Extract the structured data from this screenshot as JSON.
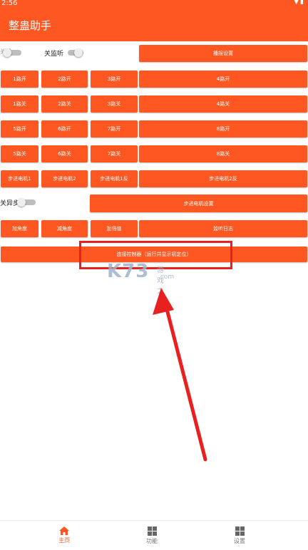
{
  "status": {
    "time": "2:56"
  },
  "app": {
    "title": "整蛊助手"
  },
  "row1": {
    "switch1_label": "关监听",
    "switch_prefix": "关提",
    "broadcast": "播报设置"
  },
  "row2": [
    "1路开",
    "2路开",
    "3路开",
    "4路开"
  ],
  "row3": [
    "1路关",
    "2路关",
    "3路关",
    "4路关"
  ],
  "row4": [
    "5路开",
    "6路开",
    "7路开",
    "8路开"
  ],
  "row5": [
    "5路关",
    "6路关",
    "7路关",
    "8路关"
  ],
  "row6": [
    "步进电机1",
    "步进电机2",
    "步进电机1反",
    "步进电机2反"
  ],
  "row7": {
    "switch_label": "关异步",
    "motor_settings": "步进电机设置"
  },
  "row8": [
    "加角度",
    "减角度",
    "加倍值",
    "监听日志"
  ],
  "connect": "连接控制器（运行并显示初定位）",
  "watermark": {
    "brand": "K73",
    "cn": "游戏之家",
    "com": ".com"
  },
  "nav": [
    {
      "label": "主页"
    },
    {
      "label": "功能"
    },
    {
      "label": "设置"
    }
  ],
  "colors": {
    "accent": "#FF5722",
    "annotation": "#E82020"
  }
}
